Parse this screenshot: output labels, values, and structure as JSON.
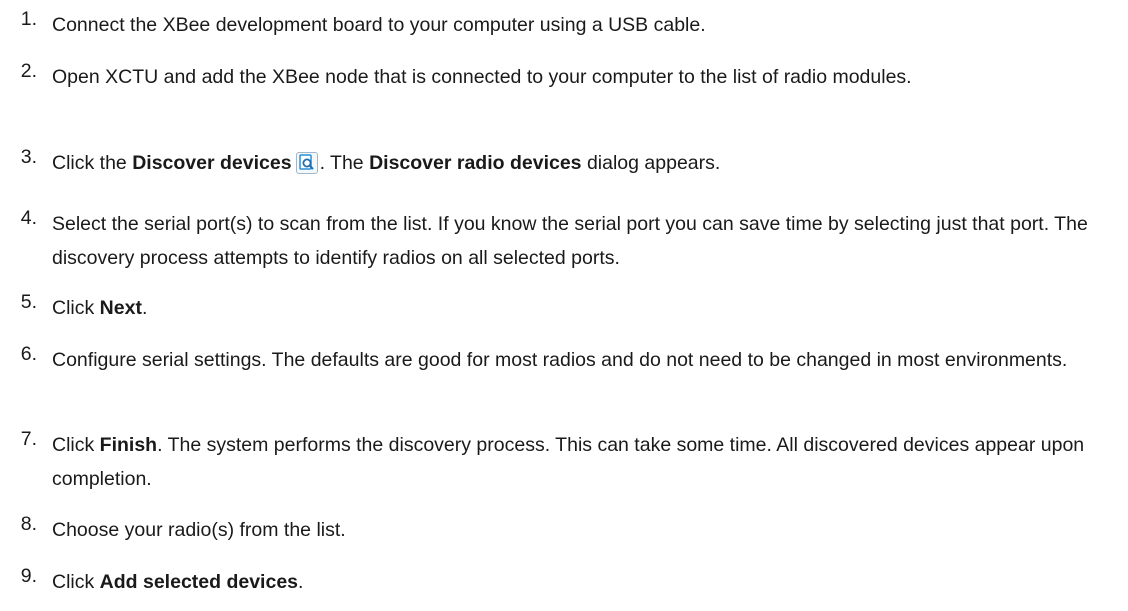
{
  "steps": [
    {
      "num": "1",
      "parts": [
        {
          "t": "Connect the XBee development board to your computer using a USB cable."
        }
      ]
    },
    {
      "num": "2",
      "parts": [
        {
          "t": "Open XCTU and add the XBee node that is connected to your computer to the list of radio modules."
        }
      ]
    },
    {
      "num": "3",
      "parts": [
        {
          "t": "Click the "
        },
        {
          "t": "Discover devices",
          "b": true
        },
        {
          "icon": "discover-devices-icon"
        },
        {
          "t": ". The "
        },
        {
          "t": "Discover radio devices",
          "b": true
        },
        {
          "t": " dialog appears."
        }
      ]
    },
    {
      "num": "4",
      "parts": [
        {
          "t": "Select the serial port(s) to scan from the list. If you know the serial port you can save time by selecting just that port. The discovery process attempts to identify radios on all selected ports."
        }
      ]
    },
    {
      "num": "5",
      "parts": [
        {
          "t": "Click "
        },
        {
          "t": "Next",
          "b": true
        },
        {
          "t": "."
        }
      ]
    },
    {
      "num": "6",
      "parts": [
        {
          "t": "Configure serial settings. The defaults are good for most radios and do not need to be changed in most environments."
        }
      ]
    },
    {
      "num": "7",
      "parts": [
        {
          "t": "Click "
        },
        {
          "t": "Finish",
          "b": true
        },
        {
          "t": ". The system performs the discovery process. This can take some time. All discovered devices appear upon completion."
        }
      ]
    },
    {
      "num": "8",
      "parts": [
        {
          "t": "Choose your radio(s) from the list."
        }
      ]
    },
    {
      "num": "9",
      "parts": [
        {
          "t": "Click "
        },
        {
          "t": "Add selected devices",
          "b": true
        },
        {
          "t": "."
        }
      ]
    }
  ]
}
